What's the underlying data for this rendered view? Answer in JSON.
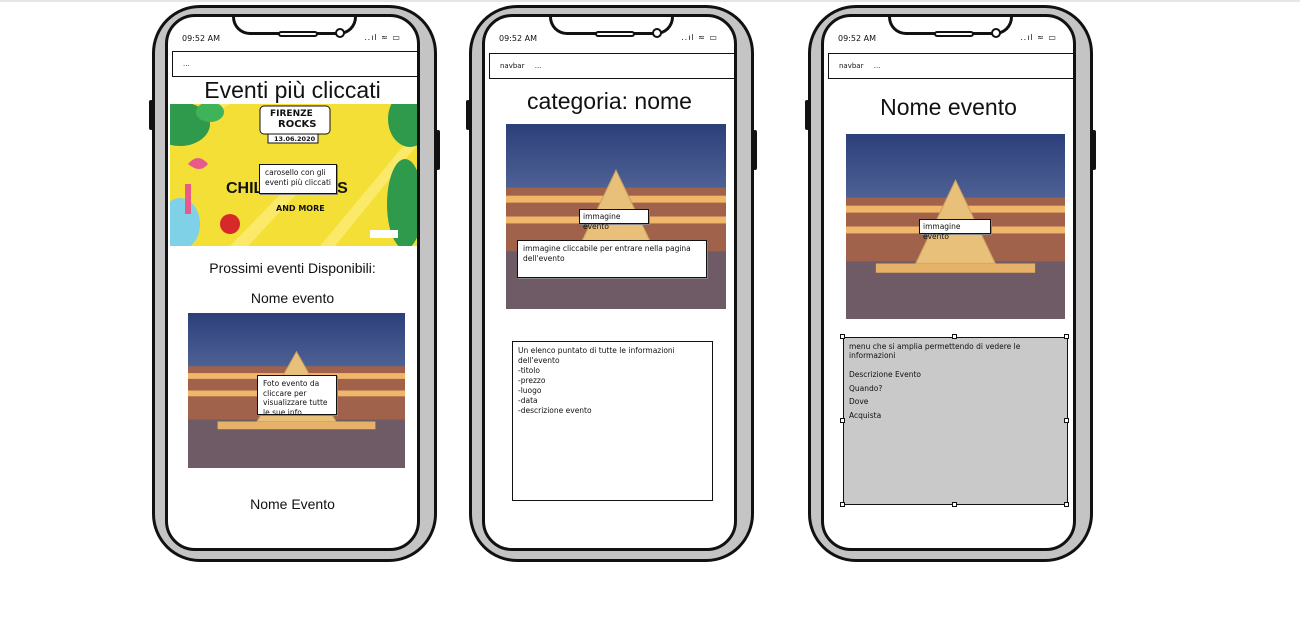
{
  "status": {
    "time": "09:52 AM",
    "icons": "..ıl ≈ ▭"
  },
  "phone1": {
    "navbar": "...",
    "title": "Eventi più cliccati",
    "poster": {
      "brand_top": "FIRENZE",
      "brand_bottom": "ROCKS",
      "date": "13.06.2020",
      "headline": "CHILI PEPPERS",
      "subline": "AND MORE"
    },
    "carousel_note": "carosello con gli eventi più cliccati",
    "next_heading": "Prossimi eventi Disponibili:",
    "event_name_1": "Nome evento",
    "photo_note": "Foto evento da cliccare per visualizzare tutte le sue info",
    "event_name_2": "Nome Evento"
  },
  "phone2": {
    "navbar_items": [
      "navbar",
      "..."
    ],
    "title": "categoria: nome",
    "image_note": "immagine evento",
    "click_note": "immagine cliccabile per entrare nella pagina dell'evento",
    "list_intro": "Un elenco puntato di tutte le informazioni dell'evento",
    "list_items": [
      "-titolo",
      "-prezzo",
      "-luogo",
      "-data",
      "-descrizione evento"
    ]
  },
  "phone3": {
    "navbar_items": [
      "navbar",
      "..."
    ],
    "title": "Nome evento",
    "image_note": "immagine evento",
    "menu_intro": "menu che si amplia permettendo di vedere le informazioni",
    "menu_items": [
      "Descrizione Evento",
      "Quando?",
      "Dove",
      "Acquista"
    ]
  }
}
